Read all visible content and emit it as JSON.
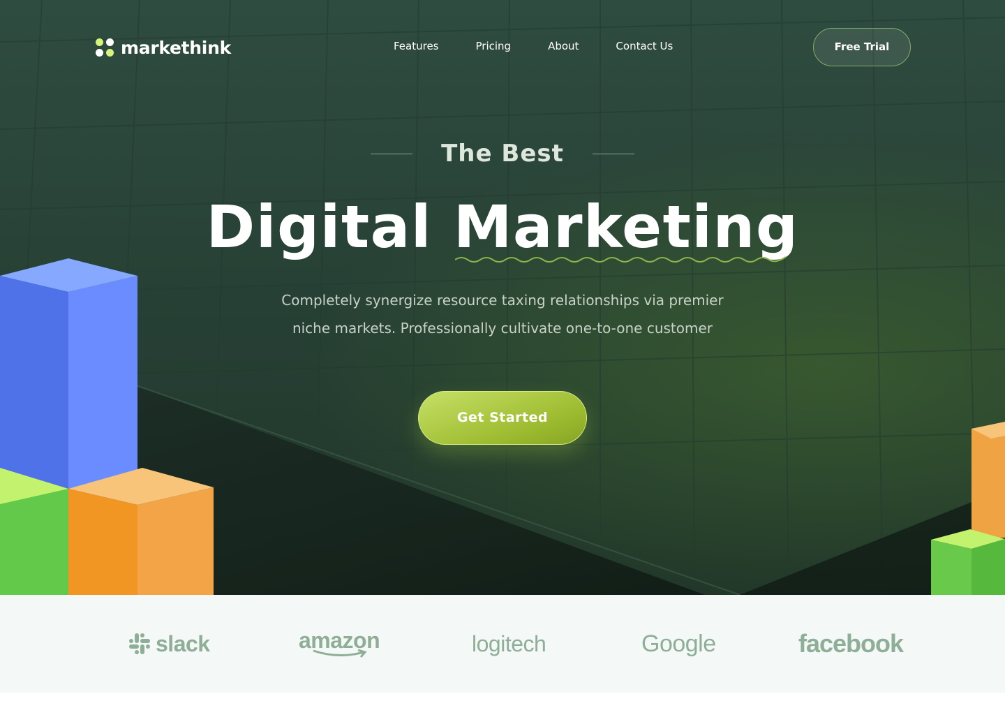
{
  "brand": {
    "name": "markethink",
    "logo_icon": "four-dots-logo-icon",
    "colors": {
      "accent_green": "#a8c63a",
      "lime_dot": "#d6f57a",
      "dark_green": "#2b4538"
    }
  },
  "nav": {
    "links": [
      "Features",
      "Pricing",
      "About",
      "Contact Us"
    ],
    "cta_label": "Free Trial"
  },
  "hero": {
    "eyebrow": "The Best",
    "headline": "Digital Marketing",
    "subtext_line1": "Completely synergize resource taxing relationships via premier",
    "subtext_line2": "niche markets. Professionally cultivate one-to-one customer",
    "cta_label": "Get Started",
    "decoration_icons": [
      "isometric-bar-blocks-icon",
      "squiggle-underline-icon"
    ]
  },
  "partners": {
    "logos": [
      "slack",
      "amazon",
      "logitech",
      "Google",
      "facebook"
    ],
    "logo_color": "#8fae97"
  }
}
